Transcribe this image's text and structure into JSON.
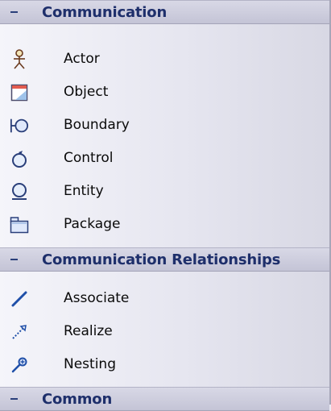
{
  "sections": [
    {
      "title": "Communication",
      "items": [
        {
          "label": "Actor",
          "icon": "actor-icon"
        },
        {
          "label": "Object",
          "icon": "object-icon"
        },
        {
          "label": "Boundary",
          "icon": "boundary-icon"
        },
        {
          "label": "Control",
          "icon": "control-icon"
        },
        {
          "label": "Entity",
          "icon": "entity-icon"
        },
        {
          "label": "Package",
          "icon": "package-icon"
        }
      ]
    },
    {
      "title": "Communication Relationships",
      "items": [
        {
          "label": "Associate",
          "icon": "associate-icon"
        },
        {
          "label": "Realize",
          "icon": "realize-icon"
        },
        {
          "label": "Nesting",
          "icon": "nesting-icon"
        }
      ]
    },
    {
      "title": "Common",
      "items": []
    }
  ],
  "colors": {
    "header_text": "#1e2f6b",
    "header_bg": "#c4c4d6",
    "panel_bg": "#e6e6f0"
  }
}
